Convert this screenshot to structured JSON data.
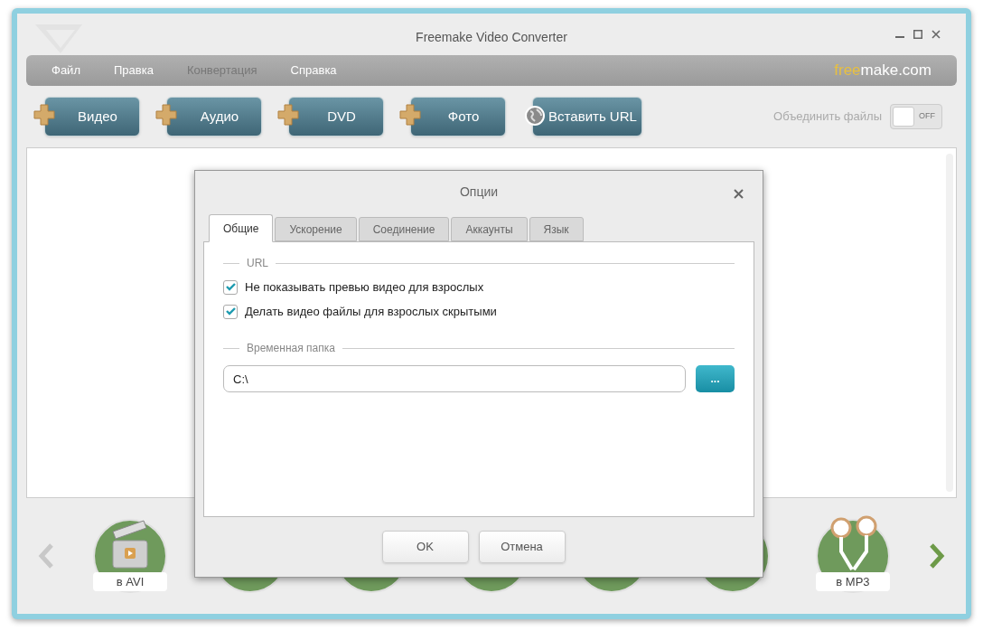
{
  "window": {
    "title": "Freemake Video Converter"
  },
  "menu": [
    {
      "label": "Файл",
      "disabled": false
    },
    {
      "label": "Правка",
      "disabled": false
    },
    {
      "label": "Конвертация",
      "disabled": true
    },
    {
      "label": "Справка",
      "disabled": false
    }
  ],
  "brand": {
    "accent": "free",
    "rest": "make.com"
  },
  "toolbar": [
    {
      "label": "Видео",
      "kind": "add"
    },
    {
      "label": "Аудио",
      "kind": "add"
    },
    {
      "label": "DVD",
      "kind": "add"
    },
    {
      "label": "Фото",
      "kind": "add"
    },
    {
      "label": "Вставить URL",
      "kind": "url"
    }
  ],
  "join_files": {
    "label": "Объединить файлы",
    "toggle_text": "OFF",
    "on": false
  },
  "formats": [
    {
      "label": "в AVI",
      "kind": "video"
    },
    {
      "kind": "blank"
    },
    {
      "kind": "blank"
    },
    {
      "kind": "blank"
    },
    {
      "kind": "blank"
    },
    {
      "kind": "blank"
    },
    {
      "label": "в MP3",
      "kind": "audio"
    }
  ],
  "dialog": {
    "title": "Опции",
    "tabs": [
      {
        "label": "Общие",
        "selected": true
      },
      {
        "label": "Ускорение",
        "selected": false
      },
      {
        "label": "Соединение",
        "selected": false
      },
      {
        "label": "Аккаунты",
        "selected": false
      },
      {
        "label": "Язык",
        "selected": false
      }
    ],
    "url_section": {
      "title": "URL",
      "options": [
        {
          "label": "Не показывать превью видео для взрослых",
          "checked": true
        },
        {
          "label": "Делать видео файлы для взрослых скрытыми",
          "checked": true
        }
      ]
    },
    "temp_section": {
      "title": "Временная папка",
      "value": "C:\\",
      "browse": "..."
    },
    "buttons": [
      "OK",
      "Отмена"
    ]
  }
}
